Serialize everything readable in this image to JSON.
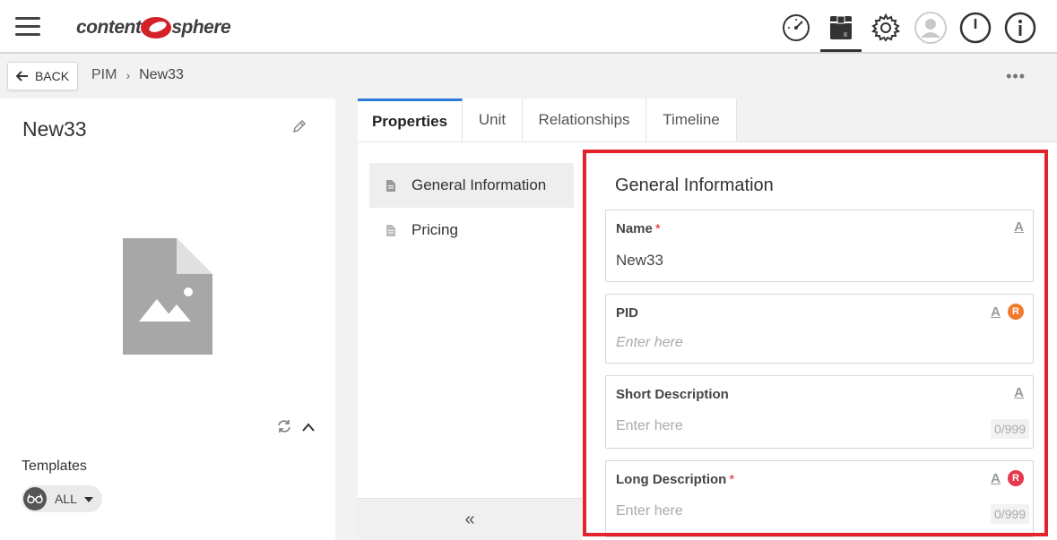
{
  "header": {
    "logo_left": "content",
    "logo_right": "sphere",
    "icons": [
      "dashboard-gauge-icon",
      "archive-box-icon",
      "gear-icon",
      "user-avatar-icon",
      "power-icon",
      "info-icon"
    ],
    "brand_color": "#d42027"
  },
  "subbar": {
    "back_label": "BACK",
    "breadcrumb": [
      "PIM",
      "New33"
    ],
    "more_label": "•••"
  },
  "left": {
    "title": "New33",
    "templates_label": "Templates",
    "templates_filter": "ALL"
  },
  "tabs": [
    {
      "label": "Properties",
      "active": true
    },
    {
      "label": "Unit",
      "active": false
    },
    {
      "label": "Relationships",
      "active": false
    },
    {
      "label": "Timeline",
      "active": false
    }
  ],
  "sections": [
    {
      "label": "General Information",
      "active": true
    },
    {
      "label": "Pricing",
      "active": false
    }
  ],
  "collapse_label": "«",
  "form": {
    "title": "General Information",
    "fields": [
      {
        "label": "Name",
        "required": "*",
        "value": "New33",
        "a_icon": "A"
      },
      {
        "label": "PID",
        "required": "",
        "placeholder": "Enter here",
        "a_icon": "A",
        "badge": "R",
        "badge_color": "#f07a2e"
      },
      {
        "label": "Short Description",
        "required": "",
        "placeholder": "Enter here",
        "a_icon": "A",
        "counter": "0/999"
      },
      {
        "label": "Long Description",
        "required": "*",
        "placeholder": "Enter here",
        "a_icon": "A",
        "badge": "R",
        "badge_color": "#e8384f",
        "counter": "0/999"
      }
    ]
  },
  "colors": {
    "highlight": "#e3222b",
    "tab_accent": "#2a7ad8"
  }
}
